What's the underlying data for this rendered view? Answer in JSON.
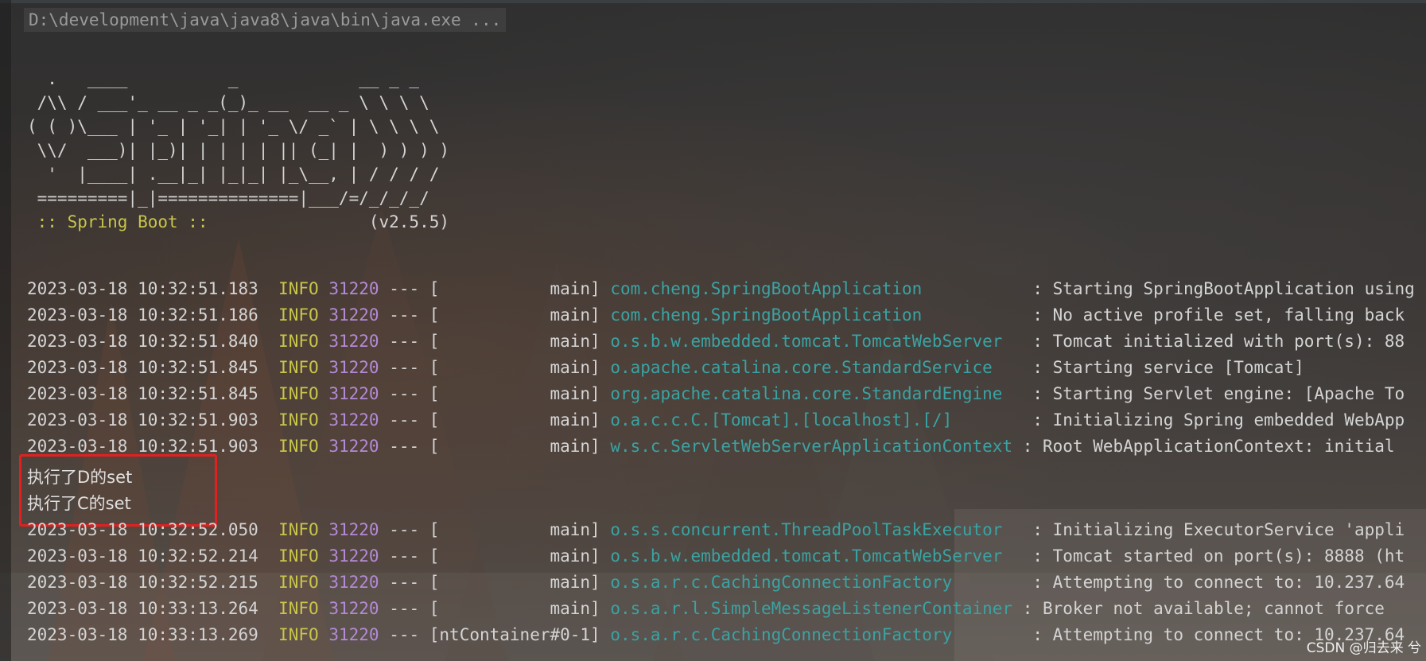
{
  "command": "D:\\development\\java\\java8\\java\\bin\\java.exe ...",
  "banner": {
    "ascii": [
      "  .   ____          _            __ _ _",
      " /\\\\ / ___'_ __ _ _(_)_ __  __ _ \\ \\ \\ \\",
      "( ( )\\___ | '_ | '_| | '_ \\/ _` | \\ \\ \\ \\",
      " \\\\/  ___)| |_)| | | | | || (_| |  ) ) ) )",
      "  '  |____| .__|_| |_|_| |_\\__, | / / / /",
      " =========|_|==============|___/=/_/_/_/"
    ],
    "spring_label": " :: Spring Boot :: ",
    "version": "               (v2.5.5)"
  },
  "logs_a": [
    {
      "ts": "2023-03-18 10:32:51.183",
      "lvl": "INFO",
      "pid": "31220",
      "sep": " --- [",
      "thread": "           main] ",
      "logger": "com.cheng.SpringBootApplication          ",
      "msg": " : Starting SpringBootApplication using"
    },
    {
      "ts": "2023-03-18 10:32:51.186",
      "lvl": "INFO",
      "pid": "31220",
      "sep": " --- [",
      "thread": "           main] ",
      "logger": "com.cheng.SpringBootApplication          ",
      "msg": " : No active profile set, falling back"
    },
    {
      "ts": "2023-03-18 10:32:51.840",
      "lvl": "INFO",
      "pid": "31220",
      "sep": " --- [",
      "thread": "           main] ",
      "logger": "o.s.b.w.embedded.tomcat.TomcatWebServer  ",
      "msg": " : Tomcat initialized with port(s): 88"
    },
    {
      "ts": "2023-03-18 10:32:51.845",
      "lvl": "INFO",
      "pid": "31220",
      "sep": " --- [",
      "thread": "           main] ",
      "logger": "o.apache.catalina.core.StandardService   ",
      "msg": " : Starting service [Tomcat]"
    },
    {
      "ts": "2023-03-18 10:32:51.845",
      "lvl": "INFO",
      "pid": "31220",
      "sep": " --- [",
      "thread": "           main] ",
      "logger": "org.apache.catalina.core.StandardEngine  ",
      "msg": " : Starting Servlet engine: [Apache To"
    },
    {
      "ts": "2023-03-18 10:32:51.903",
      "lvl": "INFO",
      "pid": "31220",
      "sep": " --- [",
      "thread": "           main] ",
      "logger": "o.a.c.c.C.[Tomcat].[localhost].[/]       ",
      "msg": " : Initializing Spring embedded WebApp"
    },
    {
      "ts": "2023-03-18 10:32:51.903",
      "lvl": "INFO",
      "pid": "31220",
      "sep": " --- [",
      "thread": "           main] ",
      "logger": "w.s.c.ServletWebServerApplicationContext",
      "msg": " : Root WebApplicationContext: initial"
    }
  ],
  "stdout": [
    "执行了D的set",
    "执行了C的set"
  ],
  "logs_b": [
    {
      "ts": "2023-03-18 10:32:52.050",
      "lvl": "INFO",
      "pid": "31220",
      "sep": " --- [",
      "thread": "           main] ",
      "logger": "o.s.s.concurrent.ThreadPoolTaskExecutor  ",
      "msg": " : Initializing ExecutorService 'appli"
    },
    {
      "ts": "2023-03-18 10:32:52.214",
      "lvl": "INFO",
      "pid": "31220",
      "sep": " --- [",
      "thread": "           main] ",
      "logger": "o.s.b.w.embedded.tomcat.TomcatWebServer  ",
      "msg": " : Tomcat started on port(s): 8888 (ht"
    },
    {
      "ts": "2023-03-18 10:32:52.215",
      "lvl": "INFO",
      "pid": "31220",
      "sep": " --- [",
      "thread": "           main] ",
      "logger": "o.s.a.r.c.CachingConnectionFactory       ",
      "msg": " : Attempting to connect to: 10.237.64"
    },
    {
      "ts": "2023-03-18 10:33:13.264",
      "lvl": "INFO",
      "pid": "31220",
      "sep": " --- [",
      "thread": "           main] ",
      "logger": "o.s.a.r.l.SimpleMessageListenerContainer",
      "msg": " : Broker not available; cannot force"
    },
    {
      "ts": "2023-03-18 10:33:13.269",
      "lvl": "INFO",
      "pid": "31220",
      "sep": " --- [",
      "thread": "ntContainer#0-1] ",
      "logger": "o.s.a.r.c.CachingConnectionFactory       ",
      "msg": " : Attempting to connect to: 10.237.64"
    }
  ],
  "watermark": "CSDN @归去来 兮",
  "colors": {
    "accent_yellow": "#c8c54a",
    "pid_purple": "#b48ad6",
    "logger_teal": "#3aa3a3",
    "highlight_red": "#e32020"
  }
}
